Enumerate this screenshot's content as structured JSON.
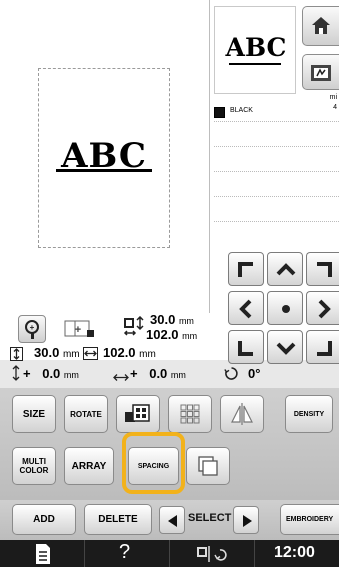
{
  "preview": {
    "main_text": "ABC",
    "thumb_text": "ABC"
  },
  "thread": {
    "color_name": "BLACK",
    "minutes_label": "mi",
    "minutes_value": "4",
    "swatch_color": "#111111"
  },
  "size_info": {
    "height_value": "30.0",
    "height_unit": "mm",
    "width_value": "102.0",
    "width_unit": "mm",
    "row1_height_value": "30.0",
    "row1_height_unit": "mm",
    "row1_width_value": "102.0",
    "row1_width_unit": "mm",
    "offset_v_prefix": "+",
    "offset_v_value": "0.0",
    "offset_v_unit": "mm",
    "offset_h_prefix": "+",
    "offset_h_value": "0.0",
    "offset_h_unit": "mm",
    "angle": "0°"
  },
  "edit_buttons": {
    "size": "SIZE",
    "rotate": "ROTATE",
    "density": "DENSITY",
    "multi_color_line1": "MULTI",
    "multi_color_line2": "COLOR",
    "array": "ARRAY",
    "spacing": "SPACING"
  },
  "bottom": {
    "add": "ADD",
    "delete": "DELETE",
    "select": "SELECT",
    "embroidery": "EMBROIDERY"
  },
  "status": {
    "help": "?",
    "time": "12:00"
  },
  "colors": {
    "highlight": "#f2b21b",
    "status_bar": "#1b1b1b"
  },
  "icons": [
    "home-icon",
    "frame-icon",
    "zoom-icon",
    "arrow-up-left-icon",
    "arrow-up-icon",
    "arrow-up-right-icon",
    "arrow-left-icon",
    "center-dot-icon",
    "arrow-right-icon",
    "arrow-down-left-icon",
    "arrow-down-icon",
    "arrow-down-right-icon",
    "mirror-icon",
    "document-icon",
    "needle-icon",
    "thread-wind-icon"
  ]
}
